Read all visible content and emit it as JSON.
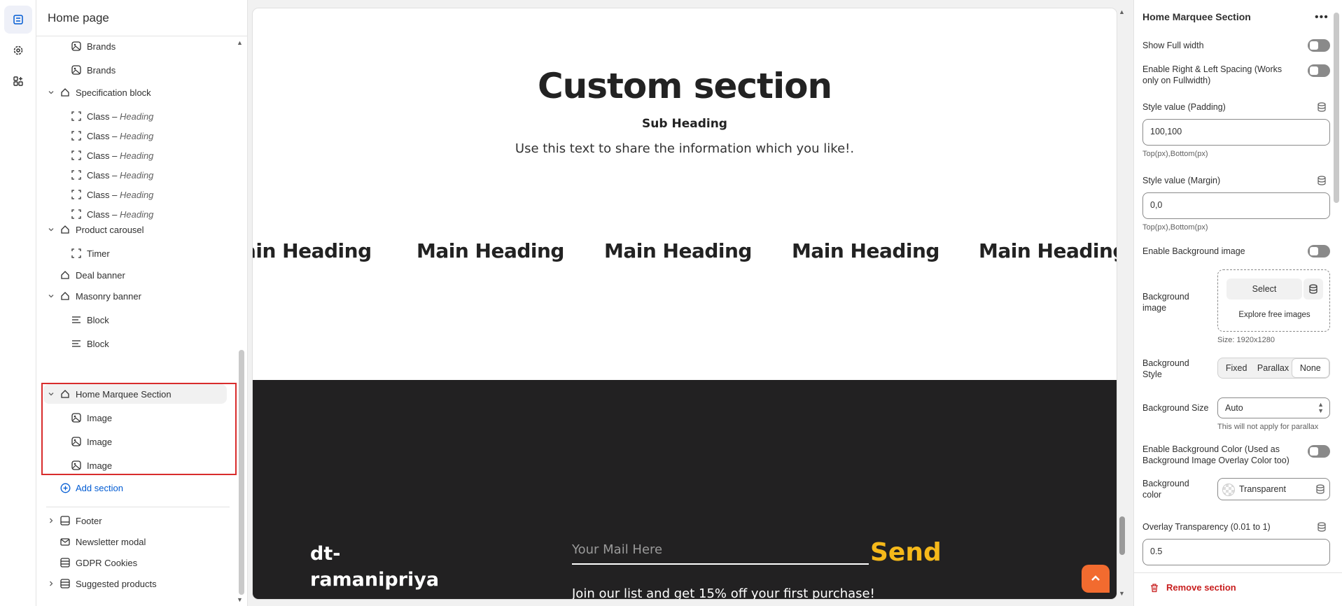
{
  "sidebar": {
    "title": "Home page",
    "items": [
      {
        "label": "Brands",
        "sub": ""
      },
      {
        "label": "Brands",
        "sub": ""
      },
      {
        "label": "Specification block",
        "sub": ""
      },
      {
        "label": "Class –",
        "sub": "Heading"
      },
      {
        "label": "Class –",
        "sub": "Heading"
      },
      {
        "label": "Class –",
        "sub": "Heading"
      },
      {
        "label": "Class –",
        "sub": "Heading"
      },
      {
        "label": "Class –",
        "sub": "Heading"
      },
      {
        "label": "Class –",
        "sub": "Heading"
      },
      {
        "label": "Product carousel",
        "sub": ""
      },
      {
        "label": "Timer",
        "sub": ""
      },
      {
        "label": "Deal banner",
        "sub": ""
      },
      {
        "label": "Masonry banner",
        "sub": ""
      },
      {
        "label": "Block",
        "sub": ""
      },
      {
        "label": "Block",
        "sub": ""
      },
      {
        "label": "Home Marquee Section",
        "sub": ""
      },
      {
        "label": "Image",
        "sub": ""
      },
      {
        "label": "Image",
        "sub": ""
      },
      {
        "label": "Image",
        "sub": ""
      }
    ],
    "add_section": "Add section",
    "footer_items": [
      {
        "label": "Footer"
      },
      {
        "label": "Newsletter modal"
      },
      {
        "label": "GDPR Cookies"
      },
      {
        "label": "Suggested products"
      }
    ]
  },
  "preview": {
    "title": "Custom section",
    "sub_heading": "Sub Heading",
    "text": "Use this text to share the information which you like!.",
    "marquee": [
      "ain Heading",
      "Main Heading",
      "Main Heading",
      "Main Heading",
      "Main Heading"
    ],
    "brand": "dt-\nramanipriya",
    "mail_placeholder": "Your Mail Here",
    "send": "Send",
    "join": "Join our list and get 15% off your first purchase!"
  },
  "settings": {
    "title": "Home Marquee Section",
    "show_full_width": "Show Full width",
    "enable_spacing": "Enable Right & Left Spacing (Works only on Fullwidth)",
    "padding_label": "Style value (Padding)",
    "padding_value": "100,100",
    "padding_help": "Top(px),Bottom(px)",
    "margin_label": "Style value (Margin)",
    "margin_value": "0,0",
    "margin_help": "Top(px),Bottom(px)",
    "enable_bg_image": "Enable Background image",
    "bg_image_label": "Background image",
    "bg_select": "Select",
    "bg_explore": "Explore free images",
    "bg_size_hint": "Size: 1920x1280",
    "bg_style_label": "Background Style",
    "bg_style_options": [
      "Fixed",
      "Parallax",
      "None"
    ],
    "bg_size_label": "Background Size",
    "bg_size_value": "Auto",
    "bg_size_help": "This will not apply for parallax",
    "enable_bg_color": "Enable Background Color (Used as Background Image Overlay Color too)",
    "bg_color_label": "Background color",
    "bg_color_value": "Transparent",
    "overlay_label": "Overlay Transparency (0.01 to 1)",
    "overlay_value": "0.5",
    "remove": "Remove section"
  },
  "colors": {
    "accent": "#005bd3",
    "highlight": "#d82c2c",
    "send": "#f6b91a",
    "danger": "#c81e1e",
    "dark": "#222122",
    "totop": "#f26b2f"
  }
}
